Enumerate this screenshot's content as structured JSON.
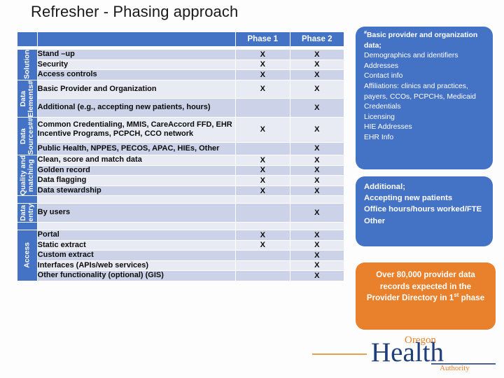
{
  "slide": {
    "title": "Refresher - Phasing approach",
    "accent_blue": "#4472C4",
    "accent_orange": "#E8802C",
    "row_shade_dark": "#CCD3E8",
    "row_shade_light": "#E8EBF4"
  },
  "table": {
    "columns": [
      "",
      "",
      "Phase 1",
      "Phase 2"
    ],
    "header": {
      "phase1": "Phase 1",
      "phase2": "Phase 2"
    },
    "groups": [
      {
        "label": "Solution",
        "rows": [
          {
            "activity": "Stand –up",
            "phase1": "X",
            "phase2": "X"
          },
          {
            "activity": "Security",
            "phase1": "X",
            "phase2": "X"
          },
          {
            "activity": "Access controls",
            "phase1": "X",
            "phase2": "X"
          }
        ]
      },
      {
        "label": "Data\nElements#",
        "rows": [
          {
            "activity": "Basic Provider and Organization",
            "phase1": "X",
            "phase2": "X"
          },
          {
            "activity": "Additional (e.g., accepting new patients, hours)",
            "phase1": "",
            "phase2": "X"
          }
        ]
      },
      {
        "label": "Data\nSources##",
        "rows": [
          {
            "activity": "Common Credentialing, MMIS, CareAccord FFD, EHR Incentive Programs, PCPCH, CCO network",
            "phase1": "X",
            "phase2": "X"
          },
          {
            "activity": "Public Health, NPPES, PECOS, APAC, HIEs, Other",
            "phase1": "",
            "phase2": "X"
          }
        ]
      },
      {
        "label": "Quality and\nmatching",
        "rows": [
          {
            "activity": "Clean, score and match data",
            "phase1": "X",
            "phase2": "X"
          },
          {
            "activity": "Golden record",
            "phase1": "X",
            "phase2": "X"
          },
          {
            "activity": "Data flagging",
            "phase1": "X",
            "phase2": "X"
          },
          {
            "activity": "Data stewardship",
            "phase1": "X",
            "phase2": "X"
          }
        ]
      },
      {
        "label": "Data\nentry",
        "rows": [
          {
            "activity": "By users",
            "phase1": "",
            "phase2": "X"
          }
        ]
      },
      {
        "label": "Access",
        "rows": [
          {
            "activity": "Portal",
            "phase1": "X",
            "phase2": "X"
          },
          {
            "activity": "Static extract",
            "phase1": "X",
            "phase2": "X"
          },
          {
            "activity": "Custom extract",
            "phase1": "",
            "phase2": "X"
          },
          {
            "activity": "Interfaces (APIs/web services)",
            "phase1": "",
            "phase2": "X"
          },
          {
            "activity": "Other functionality (optional) (GIS)",
            "phase1": "",
            "phase2": "X"
          }
        ]
      }
    ]
  },
  "callouts": {
    "elements": {
      "heading_marker": "#",
      "heading": "Basic provider and organization data;",
      "lines": [
        "Demographics and identifiers",
        "Addresses",
        "Contact info",
        "Affiliations: clinics and practices, payers, CCOs, PCPCHs, Medicaid",
        "Credentials",
        "Licensing",
        "HIE Addresses",
        "EHR Info"
      ]
    },
    "additional": {
      "heading": "Additional;",
      "lines": [
        "Accepting new patients",
        "Office hours/hours worked/FTE",
        "Other"
      ]
    },
    "records": {
      "text_before": "Over 80,000 provider data records expected in the Provider Directory in 1",
      "ordinal": "st",
      "text_after": " phase"
    }
  },
  "logo": {
    "word_oregon": "Oregon",
    "word_health": "Health",
    "word_authority": "Authority"
  }
}
